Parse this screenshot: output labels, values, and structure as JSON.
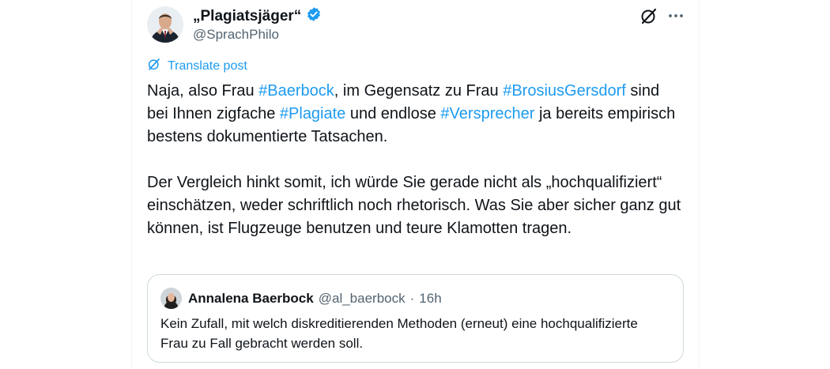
{
  "post": {
    "author_name": "„Plagiatsjäger“",
    "author_handle": "@SprachPhilo",
    "verified": true,
    "translate_label": "Translate post",
    "paragraph1": [
      {
        "text": "Naja, also Frau ",
        "hashtag": false
      },
      {
        "text": "#Baerbock",
        "hashtag": true
      },
      {
        "text": ", im Gegensatz zu Frau ",
        "hashtag": false
      },
      {
        "text": "#BrosiusGersdorf",
        "hashtag": true
      },
      {
        "text": " sind bei Ihnen zigfache ",
        "hashtag": false
      },
      {
        "text": "#Plagiate",
        "hashtag": true
      },
      {
        "text": " und endlose ",
        "hashtag": false
      },
      {
        "text": "#Versprecher",
        "hashtag": true
      },
      {
        "text": " ja bereits empirisch bestens dokumentierte Tatsachen.",
        "hashtag": false
      }
    ],
    "paragraph2": "Der Vergleich hinkt somit, ich würde Sie gerade nicht als „hochqualifiziert“ einschätzen, weder schriftlich noch rhetorisch. Was Sie aber sicher ganz gut können, ist Flugzeuge benutzen und teure Klamotten tragen."
  },
  "quote": {
    "author_name": "Annalena Baerbock",
    "author_handle": "@al_baerbock",
    "separator": "·",
    "time": "16h",
    "text": "Kein Zufall, mit welch diskreditierenden Methoden (erneut) eine hochqualifizierte Frau zu Fall gebracht werden soll."
  },
  "colors": {
    "link": "#1d9bf0",
    "text": "#0f1419",
    "secondary": "#536471",
    "border": "#cfd9de"
  },
  "icons": {
    "verified": "verified-badge-icon",
    "grok": "grok-icon",
    "more": "more-icon",
    "translate": "translate-icon"
  }
}
